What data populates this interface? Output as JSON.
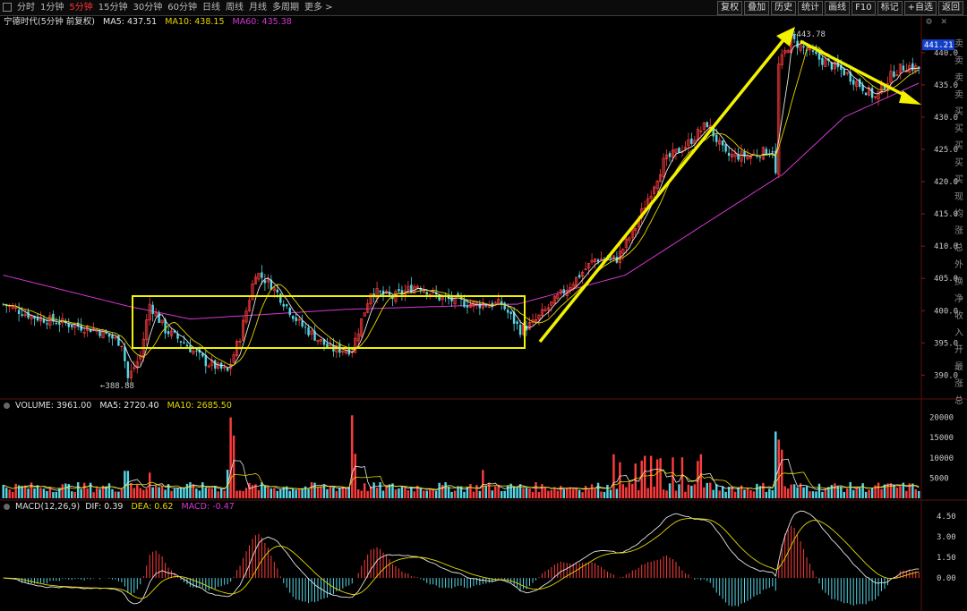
{
  "toolbar": {
    "tabs": [
      "分时",
      "1分钟",
      "5分钟",
      "15分钟",
      "30分钟",
      "60分钟",
      "日线",
      "周线",
      "月线",
      "多周期",
      "更多 >"
    ],
    "active_tab": 2,
    "tools": [
      "复权",
      "叠加",
      "历史",
      "统计",
      "画线",
      "F10",
      "标记",
      "+自选",
      "返回"
    ]
  },
  "price_panel": {
    "title": "宁德时代(5分钟 前复权)",
    "ma5": "MA5: 437.51",
    "ma10": "MA10: 438.15",
    "ma60": "MA60: 435.38",
    "high_label": "443.78",
    "low_label": "388.88",
    "current_price": "441.21",
    "axis": [
      "440.0",
      "435.0",
      "430.0",
      "425.0",
      "420.0",
      "415.0",
      "410.0",
      "405.0",
      "400.0",
      "395.0",
      "390.0"
    ]
  },
  "volume_panel": {
    "label": "VOLUME: 3961.00",
    "ma5": "MA5: 2720.40",
    "ma10": "MA10: 2685.50",
    "axis": [
      "20000",
      "15000",
      "10000",
      "5000"
    ]
  },
  "macd_panel": {
    "label": "MACD(12,26,9)",
    "dif": "DIF: 0.39",
    "dea": "DEA: 0.62",
    "macd": "MACD: -0.47",
    "axis": [
      "4.50",
      "3.00",
      "1.50",
      "0.00"
    ]
  },
  "side_text": "卖卖卖卖买买买买买现均涨总外换净收入开最涨总",
  "colors": {
    "up": "#ff3c3c",
    "down": "#55d7e6",
    "ma5": "#e6e6e6",
    "ma10": "#e6d800",
    "ma60": "#d238d2",
    "annotation": "#f2f200",
    "current_price_bg": "#1440c8"
  },
  "icons": [
    "window-icon",
    "gear-icon",
    "close-icon",
    "chevron-right-icon"
  ],
  "chart_data": {
    "type": "candlestick",
    "annotations": [
      "rectangle consolidation zone ~394.5–403",
      "arrow up from ~395 to ~443",
      "arrow down from ~441 to ~434"
    ],
    "key_points": {
      "low": 388.88,
      "high": 443.78,
      "last": 437.5
    },
    "price_axis_range": [
      387,
      444
    ]
  }
}
